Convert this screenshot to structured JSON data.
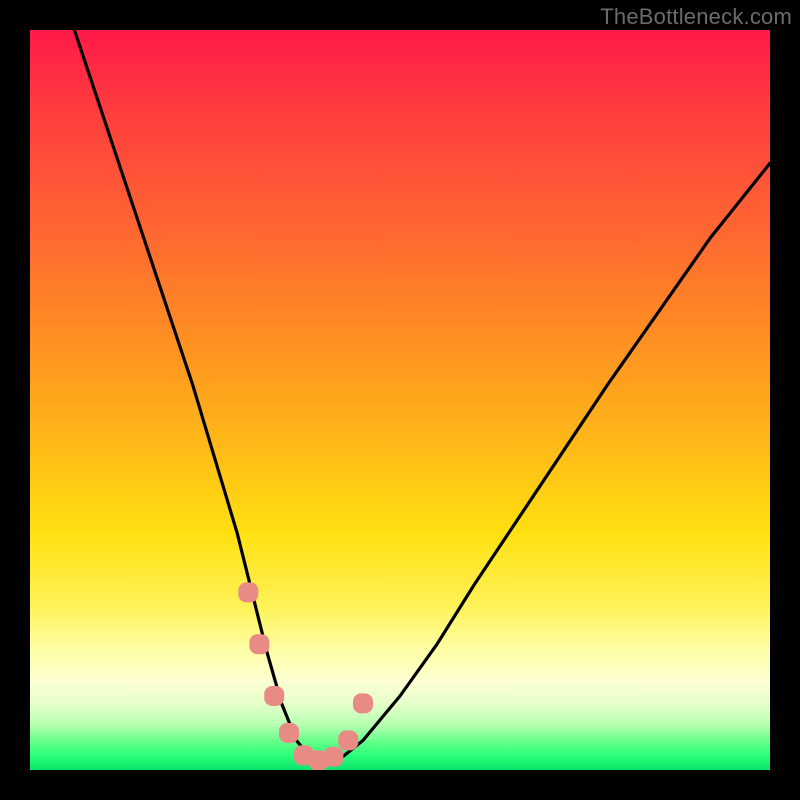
{
  "watermark": "TheBottleneck.com",
  "chart_data": {
    "type": "line",
    "title": "",
    "xlabel": "",
    "ylabel": "",
    "xlim": [
      0,
      100
    ],
    "ylim": [
      0,
      100
    ],
    "series": [
      {
        "name": "bottleneck-curve",
        "x": [
          6,
          10,
          14,
          18,
          22,
          25,
          28,
          30,
          32,
          34,
          36,
          38,
          40,
          42,
          45,
          50,
          55,
          60,
          66,
          72,
          78,
          85,
          92,
          100
        ],
        "y": [
          100,
          88,
          76,
          64,
          52,
          42,
          32,
          24,
          16,
          9,
          4,
          1.5,
          1,
          1.6,
          4,
          10,
          17,
          25,
          34,
          43,
          52,
          62,
          72,
          82
        ]
      }
    ],
    "markers": {
      "name": "highlight-points",
      "x": [
        29.5,
        31,
        33,
        35,
        37,
        39,
        41,
        43,
        45
      ],
      "y": [
        24,
        17,
        10,
        5,
        2,
        1.3,
        1.8,
        4,
        9
      ]
    },
    "colors": {
      "curve": "#000000",
      "marker": "#e98b85",
      "gradient_top": "#ff1a48",
      "gradient_bottom": "#0be36b"
    }
  }
}
